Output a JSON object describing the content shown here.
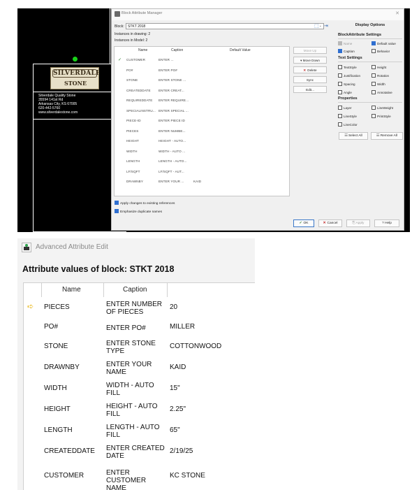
{
  "block_attribute_manager": {
    "title": "Block Attribute Manager",
    "block_label": "Block:",
    "block_value": "STKT 2018",
    "instances_in_drawing": "Instances in drawing: 2",
    "instances_in_model": "Instances in Model: 2",
    "columns": [
      "Name",
      "Caption",
      "Default Value"
    ],
    "rows": [
      {
        "name": "CUSTOMER",
        "caption": "ENTER ...",
        "default": "",
        "checked": true
      },
      {
        "name": "PO#",
        "caption": "ENTER PO#",
        "default": ""
      },
      {
        "name": "STONE",
        "caption": "ENTER STONE ...",
        "default": ""
      },
      {
        "name": "CREATEDDATE",
        "caption": "ENTER CREAT...",
        "default": ""
      },
      {
        "name": "REQUIREDDATE",
        "caption": "ENTER REQUIRE...",
        "default": ""
      },
      {
        "name": "SPECIALINSTRU...",
        "caption": "ENTER SPECIAL ...",
        "default": ""
      },
      {
        "name": "PIECE-ID",
        "caption": "ENTER PIECE ID",
        "default": ""
      },
      {
        "name": "PIECES",
        "caption": "ENTER NUMBE...",
        "default": ""
      },
      {
        "name": "HEIGHT",
        "caption": "HEIGHT - AUTO...",
        "default": ""
      },
      {
        "name": "WIDTH",
        "caption": "WIDTH - AUTO ...",
        "default": ""
      },
      {
        "name": "LENGTH",
        "caption": "LENGTH - AUTO...",
        "default": ""
      },
      {
        "name": "LF/SQFT",
        "caption": "LF/SQFT - AUT...",
        "default": ""
      },
      {
        "name": "DRAWNBY",
        "caption": "ENTER YOUR ...",
        "default": "KAID"
      }
    ],
    "buttons": {
      "move_up": "Move Up",
      "move_down": "Move Down",
      "delete": "Delete",
      "sync": "Sync",
      "edit": "Edit..."
    },
    "display_options": {
      "title": "Display Options",
      "block_attr_settings": "BlockAttribute Settings",
      "name": "Name",
      "default_value": "Default value",
      "caption": "Caption",
      "behavior": "Behavior",
      "text_settings": "Text Settings",
      "text_style": "TextStyle",
      "height": "Height",
      "justification": "Justification",
      "rotation": "Rotation",
      "spacing": "Spacing",
      "width": "Width",
      "angle": "Angle",
      "annotative": "Annotative",
      "properties": "Properties",
      "layer": "Layer",
      "line_weight": "LineWeight",
      "line_style": "LineStyle",
      "print_style": "PrintStyle",
      "line_color": "LineColor",
      "select_all": "Select All",
      "remove_all": "Remove All"
    },
    "apply_changes": "Apply changes to existing references",
    "emphasize_duplicates": "Emphasize duplicate names",
    "ok": "OK",
    "cancel": "Cancel",
    "apply": "Apply",
    "help": "Help"
  },
  "cad_drawing": {
    "logo_line1": "SILVERDALE",
    "logo_line2": "STONE",
    "company_lines": [
      "Silverdale Quality Stone",
      "35594 141st Rd",
      "Arkansas City, KS 67005",
      "620-442-5760",
      "www.silverdalestone.com"
    ]
  },
  "advanced_attribute_edit": {
    "title": "Advanced Attribute Edit",
    "heading": "Attribute values of block: STKT 2018",
    "columns": [
      "Name",
      "Caption"
    ],
    "rows": [
      {
        "name": "PIECES",
        "caption": "ENTER NUMBER OF PIECES",
        "value": "20",
        "current": true
      },
      {
        "name": "PO#",
        "caption": "ENTER PO#",
        "value": "MILLER"
      },
      {
        "name": "STONE",
        "caption": "ENTER STONE TYPE",
        "value": "COTTONWOOD"
      },
      {
        "name": "DRAWNBY",
        "caption": "ENTER YOUR NAME",
        "value": "KAID"
      },
      {
        "name": "WIDTH",
        "caption": "WIDTH - AUTO FILL",
        "value": "15\""
      },
      {
        "name": "HEIGHT",
        "caption": "HEIGHT - AUTO FILL",
        "value": "2.25\""
      },
      {
        "name": "LENGTH",
        "caption": "LENGTH - AUTO FILL",
        "value": "65\""
      },
      {
        "name": "CREATEDDATE",
        "caption": "ENTER CREATED DATE",
        "value": "2/19/25"
      },
      {
        "name": "CUSTOMER",
        "caption": "ENTER CUSTOMER NAME",
        "value": "KC STONE"
      }
    ]
  }
}
